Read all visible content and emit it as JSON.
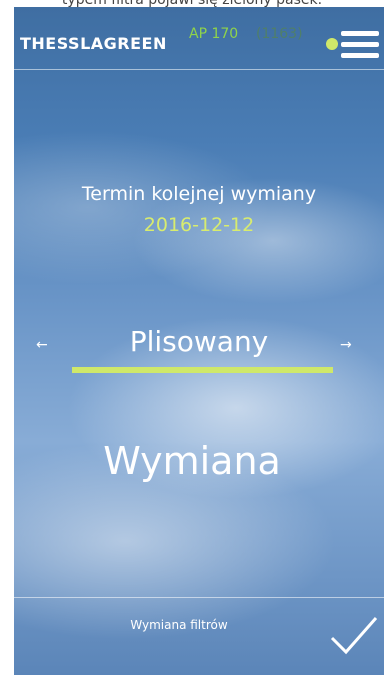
{
  "caption": "typem filtra pojawi się zielony pasek.",
  "header": {
    "brand": "THESSLAGREEN",
    "model": "AP 170",
    "serial": "(1163)",
    "status_color": "#cfe86a",
    "menu_icon": "hamburger-menu-icon"
  },
  "next_replacement": {
    "label": "Termin kolejnej wymiany",
    "date": "2016-12-12"
  },
  "filter_selector": {
    "prev_arrow": "←",
    "next_arrow": "→",
    "selected": "Plisowany",
    "underline_color": "#cfe86a"
  },
  "action": {
    "label": "Wymiana"
  },
  "footer": {
    "label": "Wymiana filtrów",
    "confirm_icon": "checkmark-icon"
  }
}
